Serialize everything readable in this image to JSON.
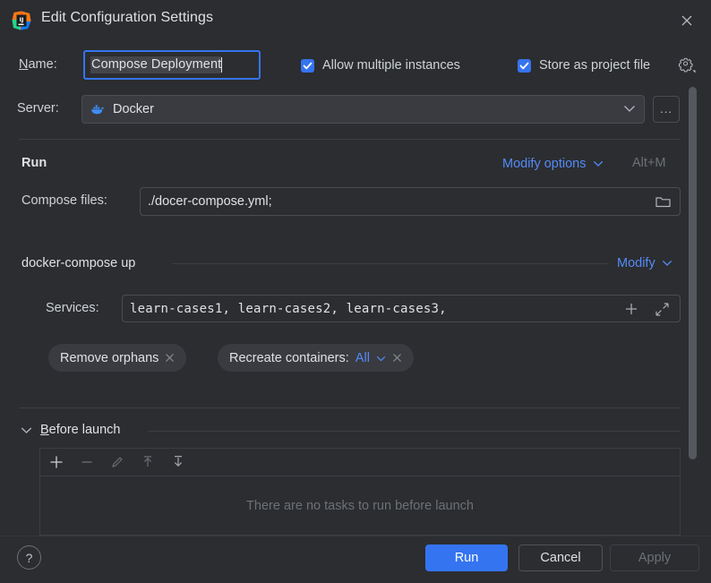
{
  "window": {
    "title": "Edit Configuration Settings",
    "app_icon": "intellij-idea-logo",
    "close_icon": "close-icon"
  },
  "name_row": {
    "label": "Name:",
    "label_mnemonic": "N",
    "value": "Compose Deployment",
    "allow_multiple": {
      "label": "Allow multiple instances",
      "checked": true
    },
    "store_as_project_file": {
      "label": "Store as project file",
      "checked": true,
      "gear_icon": "gear-icon"
    }
  },
  "server_row": {
    "label": "Server:",
    "value": "Docker",
    "icon": "docker-whale-icon",
    "chevron_icon": "chevron-down-icon",
    "more_button_label": "...",
    "more_button_name": "browse-servers-button"
  },
  "run_section": {
    "title": "Run",
    "modify_options_link": "Modify options",
    "modify_options_chevron": "chevron-down-icon",
    "modify_options_shortcut": "Alt+M",
    "compose_files": {
      "label": "Compose files:",
      "value": "./docer-compose.yml;",
      "browse_icon": "folder-icon"
    }
  },
  "compose_up_section": {
    "title": "docker-compose up",
    "modify_link": "Modify",
    "modify_chevron": "chevron-down-icon",
    "services": {
      "label": "Services:",
      "value": "learn-cases1, learn-cases2, learn-cases3,",
      "add_icon": "plus-icon",
      "expand_icon": "expand-icon"
    },
    "chips": [
      {
        "label": "Remove orphans",
        "value": null,
        "has_dropdown": false,
        "close_icon": "close-icon"
      },
      {
        "label": "Recreate containers:",
        "value": "All",
        "has_dropdown": true,
        "close_icon": "close-icon"
      }
    ]
  },
  "before_launch": {
    "title": "Before launch",
    "title_mnemonic": "B",
    "collapse_icon": "chevron-down-icon",
    "toolbar": [
      {
        "name": "add-task-button",
        "icon": "plus-icon",
        "enabled": true
      },
      {
        "name": "remove-task-button",
        "icon": "minus-icon",
        "enabled": false
      },
      {
        "name": "edit-task-button",
        "icon": "pencil-icon",
        "enabled": false
      },
      {
        "name": "move-up-button",
        "icon": "arrow-up-icon",
        "enabled": false
      },
      {
        "name": "move-down-button",
        "icon": "arrow-down-icon",
        "enabled": false
      }
    ],
    "empty_text": "There are no tasks to run before launch"
  },
  "footer": {
    "help_label": "?",
    "run_label": "Run",
    "cancel_label": "Cancel",
    "apply_label": "Apply",
    "apply_enabled": false
  },
  "colors": {
    "background": "#2b2d30",
    "accent": "#3574f0",
    "link": "#548af7",
    "text": "#dfe1e5",
    "muted": "#6d7176",
    "field_border": "#4a4d52",
    "chip_bg": "#393b40",
    "scrollbar": "#55585e"
  }
}
